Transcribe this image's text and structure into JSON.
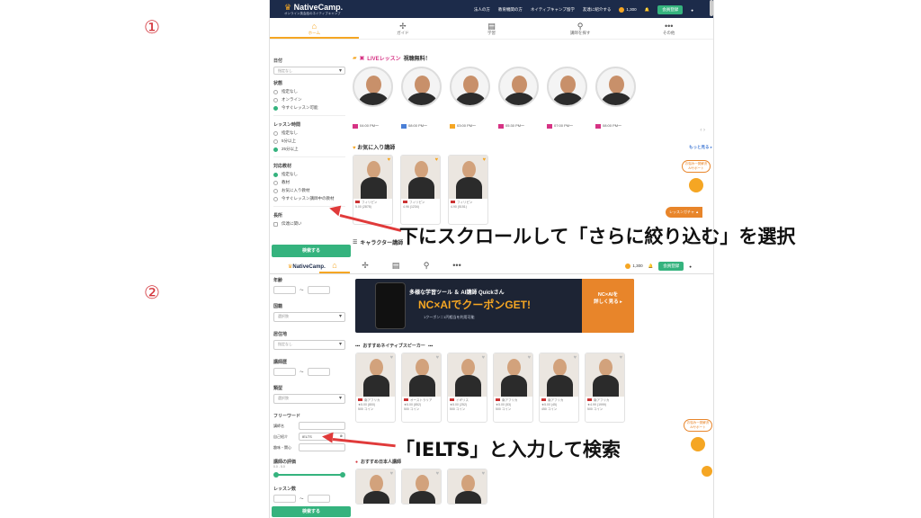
{
  "step_labels": [
    "①",
    "②"
  ],
  "header": {
    "logo": "NativeCamp.",
    "tagline": "オンライン英会話のネイティブキャンプ",
    "links": [
      "法人の方",
      "教育機関の方",
      "ネイティブキャンプ留学",
      "友達に紹介する"
    ],
    "coins": "1,300",
    "member_btn": "会員登録"
  },
  "nav": [
    {
      "icon": "home-icon",
      "label": "ホーム"
    },
    {
      "icon": "guide-icon",
      "label": "ガイド"
    },
    {
      "icon": "book-icon",
      "label": "学習"
    },
    {
      "icon": "search-icon",
      "label": "講師を探す"
    },
    {
      "icon": "more-icon",
      "label": "その他"
    }
  ],
  "filters1": {
    "date_label": "日付",
    "date_value": "指定なし",
    "status_label": "状態",
    "status_options": [
      "指定なし",
      "オンライン",
      "今すぐレッスン可能"
    ],
    "lesson_time_label": "レッスン時間",
    "lesson_time_options": [
      "指定なし",
      "5分以上",
      "25分以上"
    ],
    "material_label": "対応教材",
    "material_options": [
      "指定なし",
      "教材",
      "お気に入り教材",
      "今すぐレッスン講師中の教材"
    ],
    "features_label": "長所",
    "features_option": "伝達に関い",
    "search_btn": "検索する"
  },
  "live": {
    "title": "LIVEレッスン",
    "subtitle": "視聴無料！",
    "times": [
      "04:00 PM〜",
      "08:00 PM〜",
      "03:00 PM〜",
      "05:30 PM〜",
      "07:00 PM〜",
      "08:00 PM〜"
    ]
  },
  "favorites": {
    "title": "お気に入り講師",
    "more": "もっと見る",
    "cards": [
      {
        "country": "フィリピン",
        "stats": "5.00 (2878)"
      },
      {
        "country": "フィリピン",
        "stats": "4.96 (1234)"
      },
      {
        "country": "フィリピン",
        "stats": "4.90 (5151)"
      }
    ]
  },
  "character": {
    "title": "キャラクター講師"
  },
  "annotation1": "下にスクロールして「さらに絞り込む」を選択",
  "filters2": {
    "age_label": "年齢",
    "country_label": "国籍",
    "country_value": "選択肢",
    "residence_label": "居住地",
    "residence_value": "指定なし",
    "career_label": "講師歴",
    "type_label": "類型",
    "type_value": "選択肢",
    "freeword_label": "フリーワード",
    "teacher_name_label": "講師名",
    "self_intro_label": "自己紹介",
    "self_intro_value": "IELTS",
    "hobby_label": "趣味・関心",
    "rating_label": "講師の評価",
    "rating_range": "0.0 - 5.0",
    "lessons_label": "レッスン数",
    "search_btn": "検索する"
  },
  "banner": {
    "title": "多様な学習ツール ＆ AI講師 Quickさん",
    "big": "NC×AIでクーポンGET!",
    "sub": "1クーポン＝1円相当を利用可能",
    "side_title": "NC×AIを",
    "side_action": "詳しく見る"
  },
  "native": {
    "title": "おすすめネイティブスピーカー"
  },
  "native_cards": [
    {
      "country": "南アフリカ",
      "stats": "5.00 (800)",
      "coins": "500 コイン"
    },
    {
      "country": "オーストラリア",
      "stats": "5.00 (852)",
      "coins": "500 コイン"
    },
    {
      "country": "イギリス",
      "stats": "5.00 (252)",
      "coins": "500 コイン"
    },
    {
      "country": "南アフリカ",
      "stats": "5.00 (53)",
      "coins": "500 コイン"
    },
    {
      "country": "南アフリカ",
      "stats": "5.00 (45)",
      "coins": "450 コイン"
    },
    {
      "country": "南アフリカ",
      "stats": "4.99 (1999)",
      "coins": "500 コイン"
    }
  ],
  "japanese": {
    "title": "おすすめ日本人講師"
  },
  "annotation2": "「IELTS」と入力して検索",
  "side_badge": "お悩み一発解決 AIサポート",
  "float_tab": "レッスンガチャ"
}
